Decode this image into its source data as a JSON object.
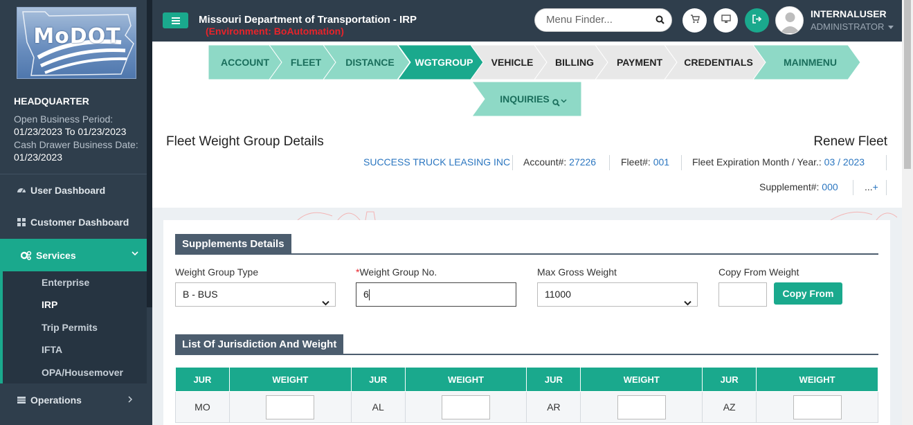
{
  "app": {
    "title": "Missouri Department of Transportation - IRP",
    "environment": "(Environment: BoAutomation)",
    "logo_text": "MoDOT"
  },
  "sidebar": {
    "office": "HEADQUARTER",
    "open_business_period_label": "Open Business Period:",
    "open_business_period_value": "01/23/2023 To 01/23/2023",
    "cash_drawer_label": "Cash Drawer Business Date:",
    "cash_drawer_value": "01/23/2023",
    "items": [
      {
        "label": "User Dashboard",
        "icon": "dashboard-icon"
      },
      {
        "label": "Customer Dashboard",
        "icon": "grid-icon"
      },
      {
        "label": "Services",
        "icon": "cogs-icon",
        "active": true
      },
      {
        "label": "Operations",
        "icon": "operations-icon"
      }
    ],
    "services_sub": [
      "Enterprise",
      "IRP",
      "Trip Permits",
      "IFTA",
      "OPA/Housemover"
    ],
    "services_sub_active": "IRP"
  },
  "topbar": {
    "search_placeholder": "Menu Finder...",
    "user_name": "INTERNALUSER",
    "user_role": "ADMINISTRATOR"
  },
  "steps": [
    "ACCOUNT",
    "FLEET",
    "DISTANCE",
    "WGTGROUP",
    "VEHICLE",
    "BILLING",
    "PAYMENT",
    "CREDENTIALS",
    "MAINMENU",
    "INQUIRIES"
  ],
  "active_step": "WGTGROUP",
  "header": {
    "page_title": "Fleet Weight Group Details",
    "mode": "Renew Fleet",
    "company": "SUCCESS TRUCK LEASING INC",
    "account_label": "Account#:",
    "account_value": "27226",
    "fleet_label": "Fleet#:",
    "fleet_value": "001",
    "expiration_label": "Fleet Expiration Month / Year.:",
    "expiration_value": "03 / 2023",
    "supplement_label": "Supplement#:",
    "supplement_value": "000",
    "more_link": "...+"
  },
  "supplements": {
    "section_title": "Supplements Details",
    "weight_group_type_label": "Weight Group Type",
    "weight_group_type_value": "B - BUS",
    "weight_group_no_label": "Weight Group No.",
    "weight_group_no_value": "6",
    "max_gross_weight_label": "Max Gross Weight",
    "max_gross_weight_value": "11000",
    "copy_from_weight_label": "Copy From Weight",
    "copy_from_weight_value": "",
    "copy_from_button": "Copy From"
  },
  "jurisdictions": {
    "section_title": "List Of Jurisdiction And Weight",
    "headers": [
      "JUR",
      "WEIGHT",
      "JUR",
      "WEIGHT",
      "JUR",
      "WEIGHT",
      "JUR",
      "WEIGHT"
    ],
    "rows": [
      [
        "MO",
        "",
        "AL",
        "",
        "AR",
        "",
        "AZ",
        ""
      ]
    ]
  },
  "colors": {
    "teal": "#1aa98d",
    "light_teal": "#8ed9c6",
    "dark_navy": "#2f3e4c",
    "link_blue": "#2b76c0",
    "env_red": "#e8232a"
  }
}
